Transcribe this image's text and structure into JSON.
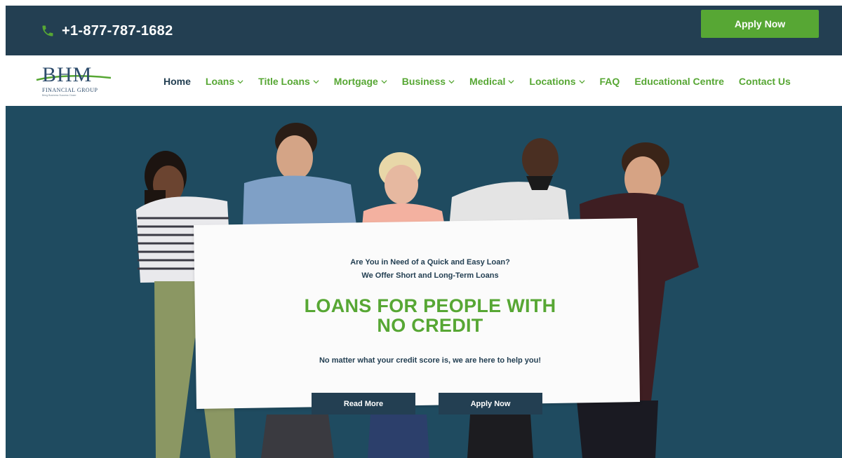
{
  "topbar": {
    "phone_icon": "phone-icon",
    "phone_number": "+1-877-787-1682",
    "apply_label": "Apply Now"
  },
  "logo": {
    "mark": "BHM",
    "name": "FINANCIAL GROUP",
    "tagline": "Bring Business Success Closer"
  },
  "nav": {
    "items": [
      {
        "label": "Home",
        "dropdown": false
      },
      {
        "label": "Loans",
        "dropdown": true
      },
      {
        "label": "Title Loans",
        "dropdown": true
      },
      {
        "label": "Mortgage",
        "dropdown": true
      },
      {
        "label": "Business",
        "dropdown": true
      },
      {
        "label": "Medical",
        "dropdown": true
      },
      {
        "label": "Locations",
        "dropdown": true
      },
      {
        "label": "FAQ",
        "dropdown": false
      },
      {
        "label": "Educational Centre",
        "dropdown": false
      },
      {
        "label": "Contact Us",
        "dropdown": false
      }
    ]
  },
  "hero": {
    "kicker_line1": "Are You in Need of a Quick and Easy Loan?",
    "kicker_line2": "We Offer Short and Long-Term Loans",
    "headline_line1": "LOANS FOR PEOPLE WITH",
    "headline_line2": "NO CREDIT",
    "subline": "No matter what your credit score is, we are here to help you!",
    "read_more_label": "Read More",
    "apply_label": "Apply Now"
  },
  "colors": {
    "brand_dark": "#233f52",
    "brand_green": "#57a734",
    "hero_bg": "#1f4b60"
  }
}
